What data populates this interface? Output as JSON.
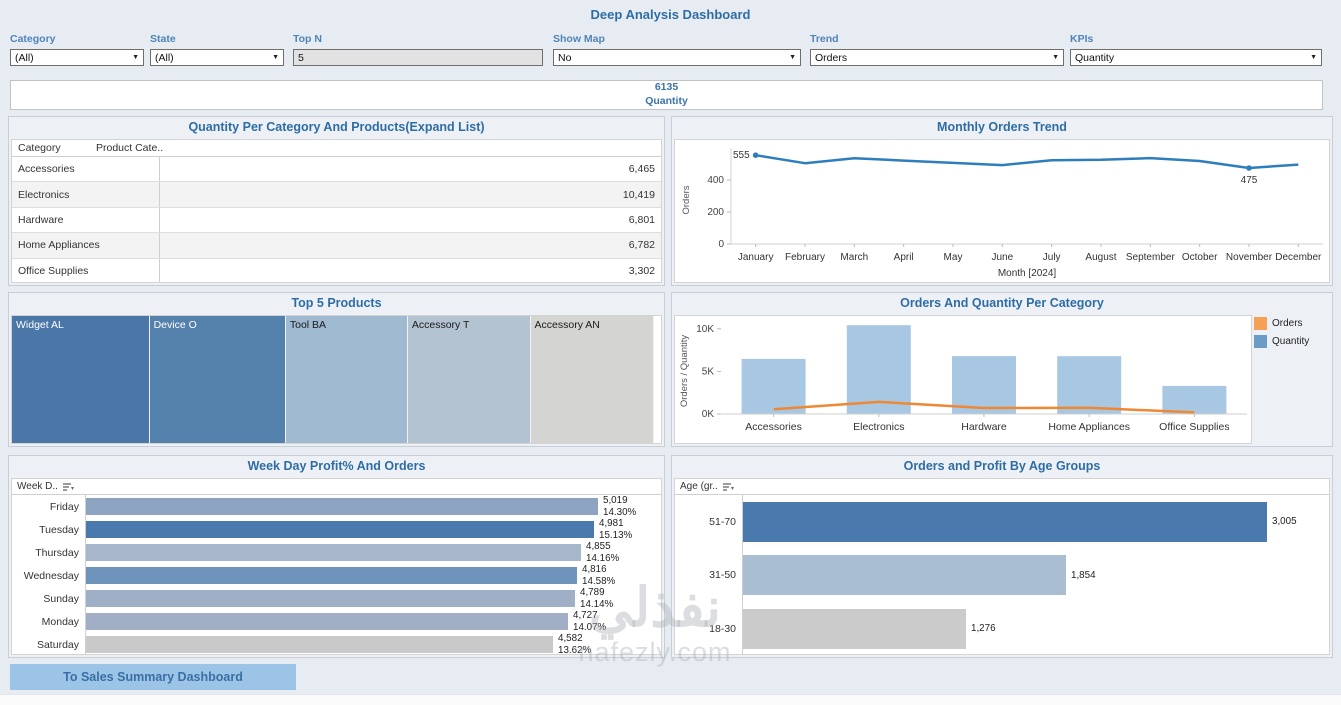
{
  "title": "Deep Analysis Dashboard",
  "filters": {
    "category": {
      "label": "Category",
      "value": "(All)"
    },
    "state": {
      "label": "State",
      "value": "(All)"
    },
    "top_n": {
      "label": "Top N",
      "value": "5"
    },
    "show_map": {
      "label": "Show Map",
      "value": "No"
    },
    "trend": {
      "label": "Trend",
      "value": "Orders"
    },
    "kpis": {
      "label": "KPIs",
      "value": "Quantity"
    }
  },
  "kpi": {
    "value": "6135",
    "label": "Quantity"
  },
  "panels": {
    "category_products": {
      "title": "Quantity Per Category And Products(Expand List)",
      "col1": "Category",
      "col2": "Product Cate.."
    },
    "monthly_trend": {
      "title": "Monthly Orders Trend"
    },
    "top_products": {
      "title": "Top 5 Products"
    },
    "orders_quantity": {
      "title": "Orders And Quantity Per Category"
    },
    "weekday": {
      "title": "Week Day Profit% And Orders",
      "header": "Week D.."
    },
    "age_groups": {
      "title": "Orders and Profit By Age Groups",
      "header": "Age (gr.."
    }
  },
  "button": {
    "label": "To Sales Summary Dashboard"
  },
  "watermark": {
    "line1": "نفذلي",
    "line2": "nafezly.com"
  },
  "colors": {
    "title_blue": "#2e6da4",
    "line_blue": "#2e7ebc",
    "bar_light_blue": "#a8c7e3",
    "orders_orange": "#ee8833",
    "legend_orders": "#f5a054",
    "legend_quantity": "#6b9cc6"
  },
  "chart_data": [
    {
      "id": "category_table",
      "type": "table",
      "columns": [
        "Category",
        "Product Cate.."
      ],
      "categories": [
        "Accessories",
        "Electronics",
        "Hardware",
        "Home Appliances",
        "Office Supplies"
      ],
      "values": [
        6465,
        10419,
        6801,
        6782,
        3302
      ],
      "values_formatted": [
        "6,465",
        "10,419",
        "6,801",
        "6,782",
        "3,302"
      ],
      "title": "Quantity Per Category And Products(Expand List)"
    },
    {
      "id": "monthly_trend",
      "type": "line",
      "title": "Monthly Orders Trend",
      "x": [
        "January",
        "February",
        "March",
        "April",
        "May",
        "June",
        "July",
        "August",
        "September",
        "October",
        "November",
        "December"
      ],
      "values": [
        555,
        505,
        536,
        521,
        507,
        493,
        524,
        526,
        537,
        519,
        475,
        496
      ],
      "ylabel": "Orders",
      "xlabel": "Month [2024]",
      "yticks": [
        0,
        200,
        400
      ],
      "ylim": [
        0,
        600
      ],
      "grid": false,
      "annotations": [
        {
          "index": 0,
          "label": "555"
        },
        {
          "index": 10,
          "label": "475"
        }
      ],
      "line_color": "#2e7ebc"
    },
    {
      "id": "top_products",
      "type": "treemap",
      "title": "Top 5 Products",
      "items": [
        {
          "label": "Widget AL",
          "color": "#4a76a8",
          "text": "#ffffff",
          "weight": 21.2
        },
        {
          "label": "Device O",
          "color": "#5480ac",
          "text": "#ffffff",
          "weight": 21.0
        },
        {
          "label": "Tool BA",
          "color": "#9fb9d0",
          "text": "#1a1a1a",
          "weight": 18.8
        },
        {
          "label": "Accessory T",
          "color": "#b4c3d1",
          "text": "#1a1a1a",
          "weight": 18.9
        },
        {
          "label": "Accessory AN",
          "color": "#d4d5d2",
          "text": "#1a1a1a",
          "weight": 19.1
        }
      ]
    },
    {
      "id": "orders_quantity",
      "type": "combo",
      "title": "Orders And Quantity Per Category",
      "categories": [
        "Accessories",
        "Electronics",
        "Hardware",
        "Home Appliances",
        "Office Supplies"
      ],
      "series": [
        {
          "name": "Quantity",
          "type": "bar",
          "color": "#a8c7e3",
          "values": [
            6465,
            10419,
            6801,
            6782,
            3302
          ]
        },
        {
          "name": "Orders",
          "type": "line",
          "color": "#ee8833",
          "values": [
            560,
            1420,
            700,
            730,
            190
          ]
        }
      ],
      "yticks": [
        "0K",
        "5K",
        "10K"
      ],
      "ytick_values": [
        0,
        5000,
        10000
      ],
      "ylim": [
        0,
        10800
      ],
      "ylabel": "Orders / Quantity",
      "legend": [
        "Orders",
        "Quantity"
      ],
      "legend_position": "top-right",
      "grid": false
    },
    {
      "id": "weekday",
      "type": "hbar",
      "title": "Week Day Profit% And Orders",
      "categories": [
        "Friday",
        "Tuesday",
        "Thursday",
        "Wednesday",
        "Sunday",
        "Monday",
        "Saturday"
      ],
      "values": [
        5019,
        4981,
        4855,
        4816,
        4789,
        4727,
        4582
      ],
      "labels": [
        [
          "5,019",
          "14.30%"
        ],
        [
          "4,981",
          "15.13%"
        ],
        [
          "4,855",
          "14.16%"
        ],
        [
          "4,816",
          "14.58%"
        ],
        [
          "4,789",
          "14.14%"
        ],
        [
          "4,727",
          "14.07%"
        ],
        [
          "4,582",
          "13.62%"
        ]
      ],
      "colors": [
        "#8da4c0",
        "#4a79ad",
        "#a7b6ca",
        "#6f94bb",
        "#9fb0c6",
        "#a2aec5",
        "#c9c9c9"
      ]
    },
    {
      "id": "age",
      "type": "hbar",
      "title": "Orders and Profit By Age Groups",
      "categories": [
        "51-70",
        "31-50",
        "18-30"
      ],
      "values": [
        3005,
        1854,
        1276
      ],
      "labels": [
        "3,005",
        "1,854",
        "1,276"
      ],
      "colors": [
        "#4a79ad",
        "#a9bdd3",
        "#cbcbcb"
      ]
    }
  ]
}
